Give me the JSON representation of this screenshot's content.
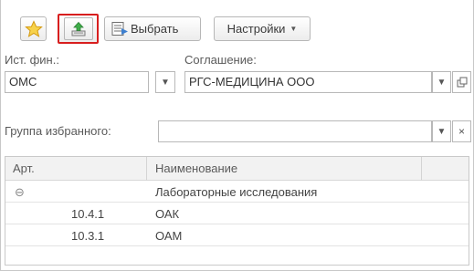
{
  "toolbar": {
    "favorite_icon": "star-icon",
    "upload_icon": "upload-icon",
    "select_icon": "select-list-icon",
    "select_label": "Выбрать",
    "settings_label": "Настройки",
    "highlight_color": "#d81e1e"
  },
  "filters": {
    "source_label": "Ист. фин.:",
    "source_value": "ОМС",
    "agreement_label": "Соглашение:",
    "agreement_value": "РГС-МЕДИЦИНА ООО",
    "favorites_group_label": "Группа избранного:",
    "favorites_group_value": ""
  },
  "table": {
    "columns": [
      "Арт.",
      "Наименование"
    ],
    "group_row": {
      "toggle_symbol": "⊖",
      "name": "Лабораторные исследования"
    },
    "rows": [
      {
        "article": "10.4.1",
        "name": "ОАК"
      },
      {
        "article": "10.3.1",
        "name": "ОАМ"
      }
    ]
  }
}
